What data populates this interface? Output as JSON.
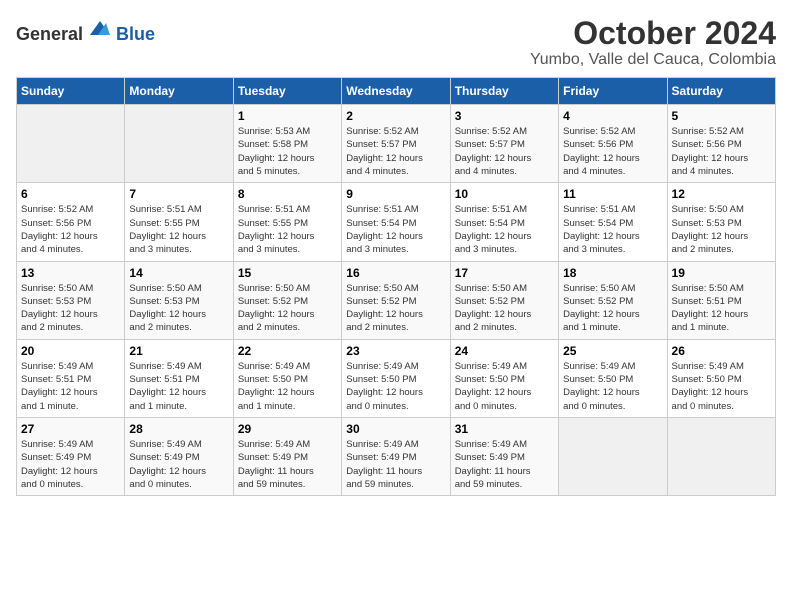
{
  "logo": {
    "text_general": "General",
    "text_blue": "Blue"
  },
  "title": "October 2024",
  "location": "Yumbo, Valle del Cauca, Colombia",
  "days_of_week": [
    "Sunday",
    "Monday",
    "Tuesday",
    "Wednesday",
    "Thursday",
    "Friday",
    "Saturday"
  ],
  "weeks": [
    [
      {
        "day": "",
        "detail": ""
      },
      {
        "day": "",
        "detail": ""
      },
      {
        "day": "1",
        "detail": "Sunrise: 5:53 AM\nSunset: 5:58 PM\nDaylight: 12 hours\nand 5 minutes."
      },
      {
        "day": "2",
        "detail": "Sunrise: 5:52 AM\nSunset: 5:57 PM\nDaylight: 12 hours\nand 4 minutes."
      },
      {
        "day": "3",
        "detail": "Sunrise: 5:52 AM\nSunset: 5:57 PM\nDaylight: 12 hours\nand 4 minutes."
      },
      {
        "day": "4",
        "detail": "Sunrise: 5:52 AM\nSunset: 5:56 PM\nDaylight: 12 hours\nand 4 minutes."
      },
      {
        "day": "5",
        "detail": "Sunrise: 5:52 AM\nSunset: 5:56 PM\nDaylight: 12 hours\nand 4 minutes."
      }
    ],
    [
      {
        "day": "6",
        "detail": "Sunrise: 5:52 AM\nSunset: 5:56 PM\nDaylight: 12 hours\nand 4 minutes."
      },
      {
        "day": "7",
        "detail": "Sunrise: 5:51 AM\nSunset: 5:55 PM\nDaylight: 12 hours\nand 3 minutes."
      },
      {
        "day": "8",
        "detail": "Sunrise: 5:51 AM\nSunset: 5:55 PM\nDaylight: 12 hours\nand 3 minutes."
      },
      {
        "day": "9",
        "detail": "Sunrise: 5:51 AM\nSunset: 5:54 PM\nDaylight: 12 hours\nand 3 minutes."
      },
      {
        "day": "10",
        "detail": "Sunrise: 5:51 AM\nSunset: 5:54 PM\nDaylight: 12 hours\nand 3 minutes."
      },
      {
        "day": "11",
        "detail": "Sunrise: 5:51 AM\nSunset: 5:54 PM\nDaylight: 12 hours\nand 3 minutes."
      },
      {
        "day": "12",
        "detail": "Sunrise: 5:50 AM\nSunset: 5:53 PM\nDaylight: 12 hours\nand 2 minutes."
      }
    ],
    [
      {
        "day": "13",
        "detail": "Sunrise: 5:50 AM\nSunset: 5:53 PM\nDaylight: 12 hours\nand 2 minutes."
      },
      {
        "day": "14",
        "detail": "Sunrise: 5:50 AM\nSunset: 5:53 PM\nDaylight: 12 hours\nand 2 minutes."
      },
      {
        "day": "15",
        "detail": "Sunrise: 5:50 AM\nSunset: 5:52 PM\nDaylight: 12 hours\nand 2 minutes."
      },
      {
        "day": "16",
        "detail": "Sunrise: 5:50 AM\nSunset: 5:52 PM\nDaylight: 12 hours\nand 2 minutes."
      },
      {
        "day": "17",
        "detail": "Sunrise: 5:50 AM\nSunset: 5:52 PM\nDaylight: 12 hours\nand 2 minutes."
      },
      {
        "day": "18",
        "detail": "Sunrise: 5:50 AM\nSunset: 5:52 PM\nDaylight: 12 hours\nand 1 minute."
      },
      {
        "day": "19",
        "detail": "Sunrise: 5:50 AM\nSunset: 5:51 PM\nDaylight: 12 hours\nand 1 minute."
      }
    ],
    [
      {
        "day": "20",
        "detail": "Sunrise: 5:49 AM\nSunset: 5:51 PM\nDaylight: 12 hours\nand 1 minute."
      },
      {
        "day": "21",
        "detail": "Sunrise: 5:49 AM\nSunset: 5:51 PM\nDaylight: 12 hours\nand 1 minute."
      },
      {
        "day": "22",
        "detail": "Sunrise: 5:49 AM\nSunset: 5:50 PM\nDaylight: 12 hours\nand 1 minute."
      },
      {
        "day": "23",
        "detail": "Sunrise: 5:49 AM\nSunset: 5:50 PM\nDaylight: 12 hours\nand 0 minutes."
      },
      {
        "day": "24",
        "detail": "Sunrise: 5:49 AM\nSunset: 5:50 PM\nDaylight: 12 hours\nand 0 minutes."
      },
      {
        "day": "25",
        "detail": "Sunrise: 5:49 AM\nSunset: 5:50 PM\nDaylight: 12 hours\nand 0 minutes."
      },
      {
        "day": "26",
        "detail": "Sunrise: 5:49 AM\nSunset: 5:50 PM\nDaylight: 12 hours\nand 0 minutes."
      }
    ],
    [
      {
        "day": "27",
        "detail": "Sunrise: 5:49 AM\nSunset: 5:49 PM\nDaylight: 12 hours\nand 0 minutes."
      },
      {
        "day": "28",
        "detail": "Sunrise: 5:49 AM\nSunset: 5:49 PM\nDaylight: 12 hours\nand 0 minutes."
      },
      {
        "day": "29",
        "detail": "Sunrise: 5:49 AM\nSunset: 5:49 PM\nDaylight: 11 hours\nand 59 minutes."
      },
      {
        "day": "30",
        "detail": "Sunrise: 5:49 AM\nSunset: 5:49 PM\nDaylight: 11 hours\nand 59 minutes."
      },
      {
        "day": "31",
        "detail": "Sunrise: 5:49 AM\nSunset: 5:49 PM\nDaylight: 11 hours\nand 59 minutes."
      },
      {
        "day": "",
        "detail": ""
      },
      {
        "day": "",
        "detail": ""
      }
    ]
  ]
}
